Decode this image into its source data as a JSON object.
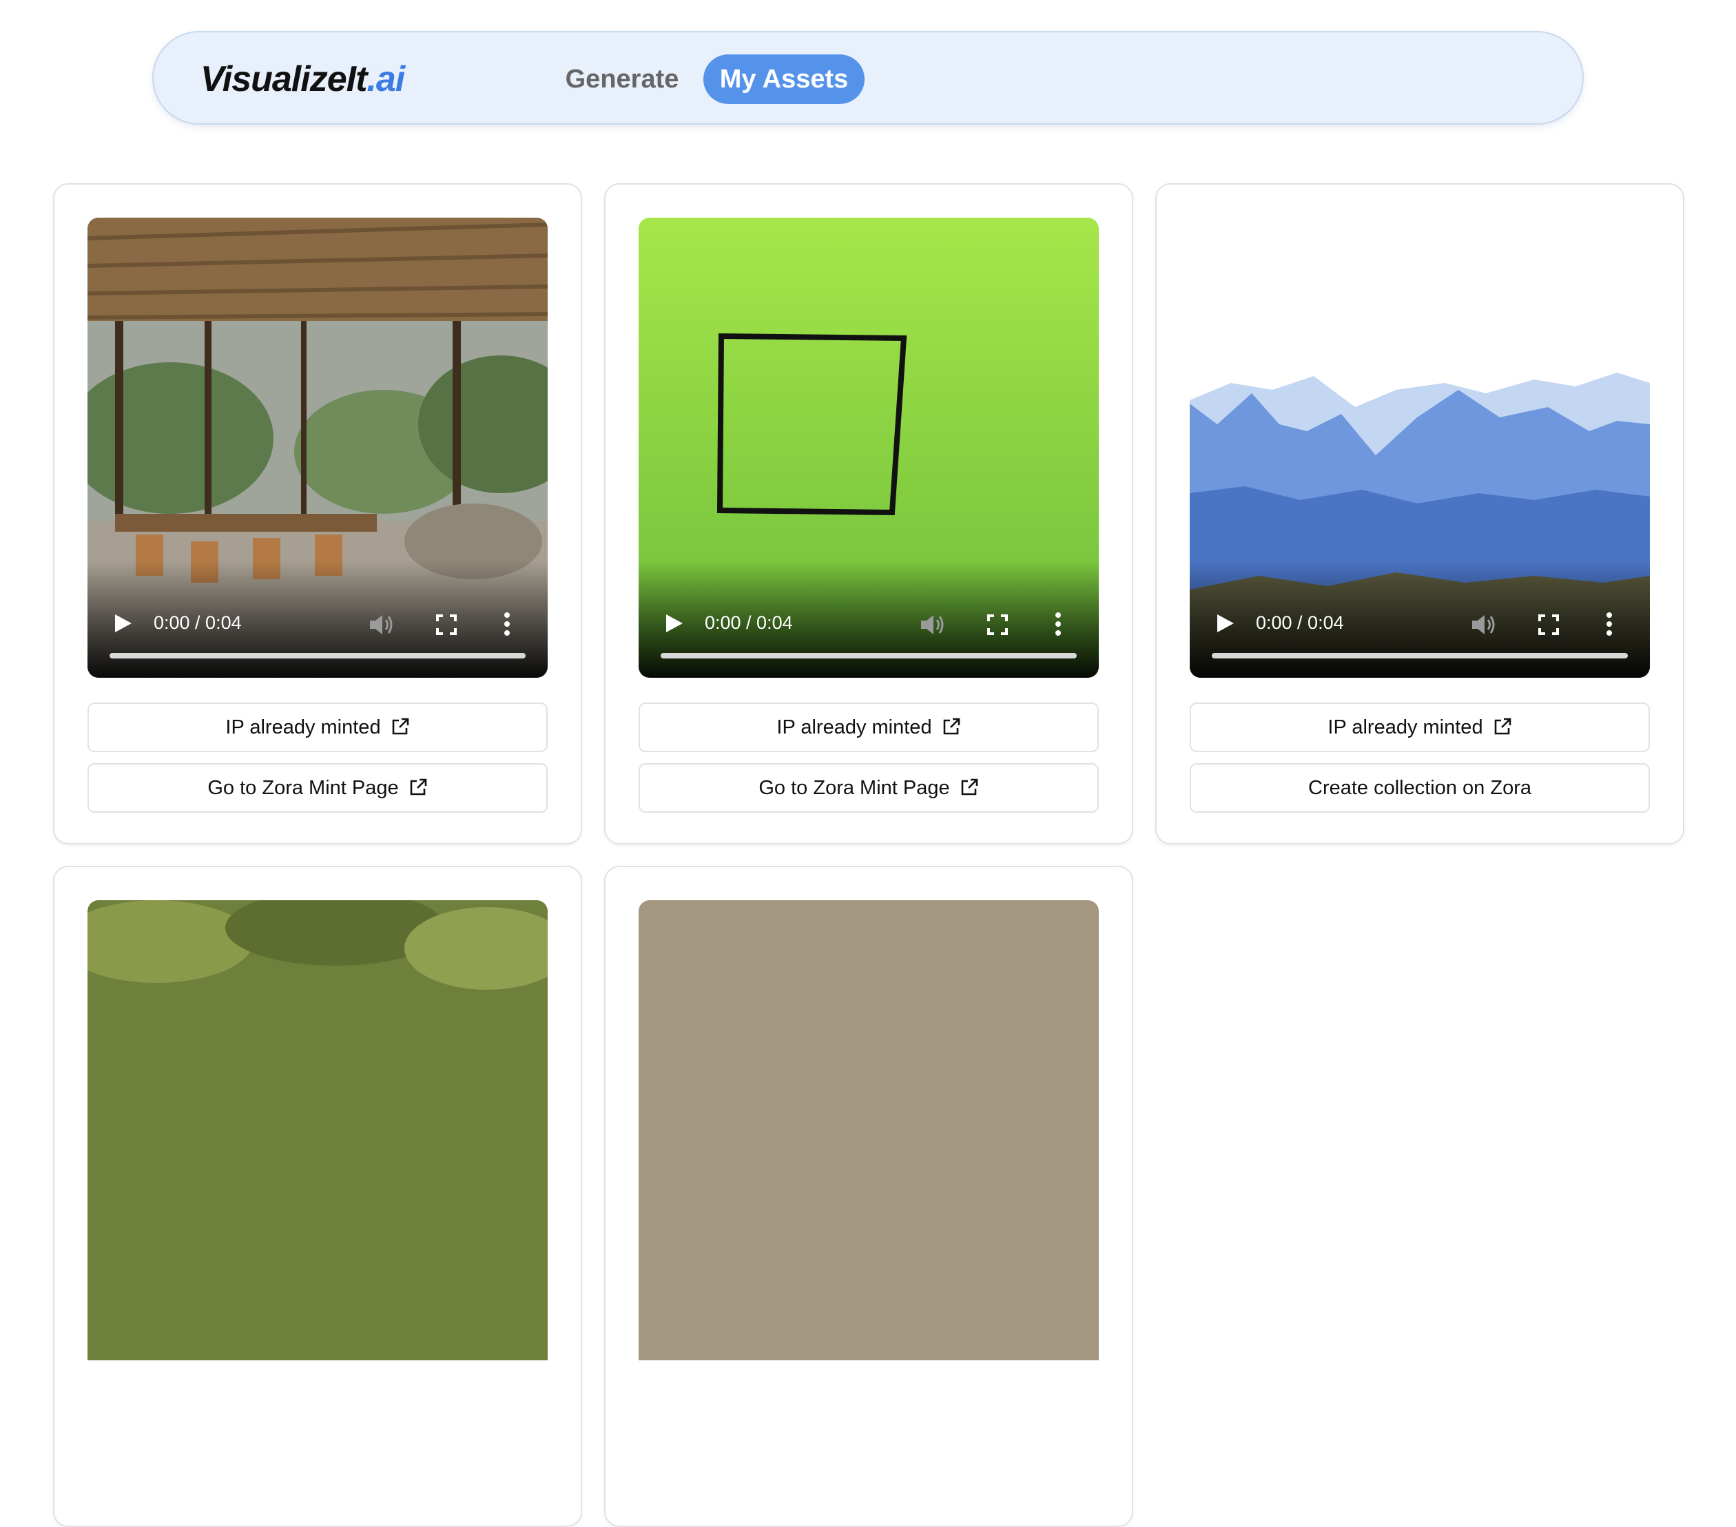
{
  "app": {
    "logo_main": "VisualizeIt",
    "logo_suffix": ".ai"
  },
  "nav": {
    "generate_label": "Generate",
    "assets_label": "My Assets",
    "active": "My Assets"
  },
  "colors": {
    "accent": "#5592ea",
    "logo_accent": "#3b7ce4",
    "nav_background": "#e8f0fc"
  },
  "assets": [
    {
      "scene": "interior-room",
      "time": "0:00 / 0:04",
      "minted_label": "IP already minted",
      "action_label": "Go to Zora Mint Page",
      "action_external": true
    },
    {
      "scene": "green-square",
      "time": "0:00 / 0:04",
      "minted_label": "IP already minted",
      "action_label": "Go to Zora Mint Page",
      "action_external": true
    },
    {
      "scene": "blue-mountains",
      "time": "0:00 / 0:04",
      "minted_label": "IP already minted",
      "action_label": "Create collection on Zora",
      "action_external": false
    },
    {
      "scene": "forest"
    },
    {
      "scene": "beige"
    }
  ],
  "icons": [
    "play-icon",
    "volume-icon",
    "fullscreen-icon",
    "more-options-icon",
    "external-link-icon"
  ]
}
